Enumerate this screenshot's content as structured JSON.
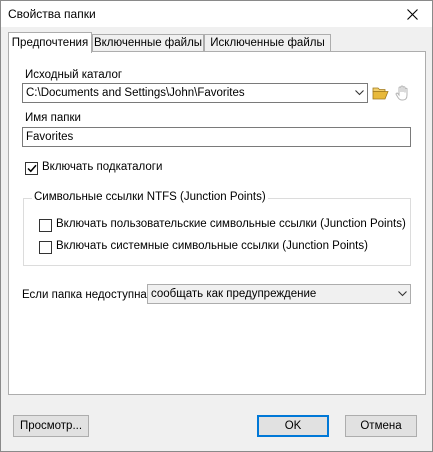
{
  "window": {
    "title": "Свойства папки"
  },
  "tabs": [
    {
      "label": "Предпочтения",
      "active": true
    },
    {
      "label": "Включенные файлы",
      "active": false
    },
    {
      "label": "Исключенные файлы",
      "active": false
    }
  ],
  "source": {
    "label": "Исходный каталог",
    "value": "C:\\Documents and Settings\\John\\Favorites"
  },
  "folder_name": {
    "label": "Имя папки",
    "value": "Favorites"
  },
  "include_subfolders": {
    "label": "Включать подкаталоги",
    "checked": true
  },
  "junction_group": {
    "title": "Символьные ссылки NTFS (Junction Points)",
    "user_links": {
      "label": "Включать пользовательские символьные ссылки (Junction Points)",
      "checked": false
    },
    "system_links": {
      "label": "Включать системные символьные ссылки (Junction Points)",
      "checked": false
    }
  },
  "unavailable": {
    "label": "Если папка недоступна",
    "value": "сообщать как предупреждение"
  },
  "buttons": {
    "preview": "Просмотр...",
    "ok": "OK",
    "cancel": "Отмена"
  },
  "colors": {
    "accent": "#0078d7",
    "folder_icon": "#e8b93a"
  },
  "icons": {
    "browse": "folder-open-icon",
    "disabled_action": "hand-icon",
    "close": "close-icon"
  }
}
